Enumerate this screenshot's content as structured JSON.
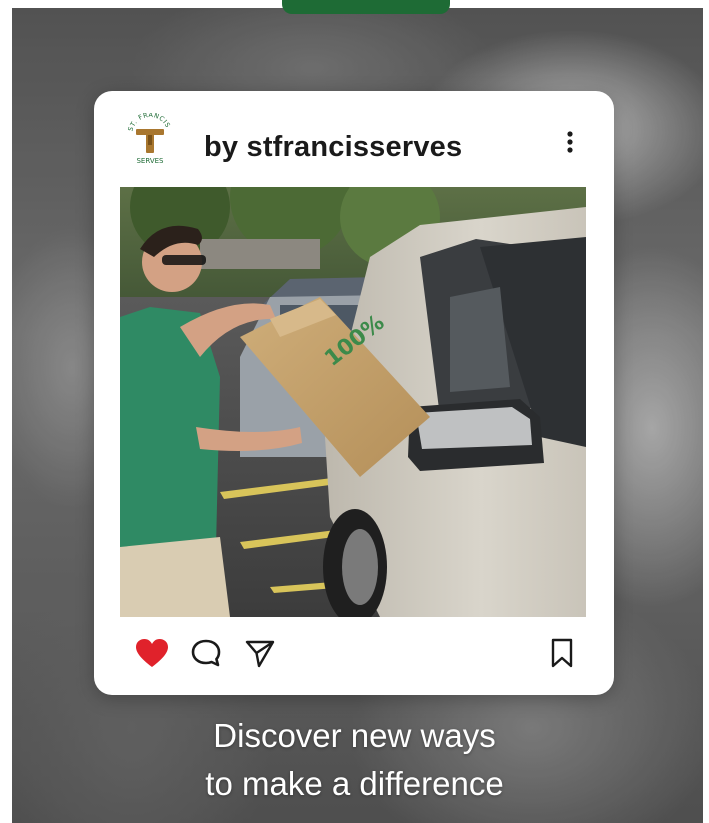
{
  "post": {
    "author_label": "by stfrancisserves",
    "logo_text_top": "ST. FRANCIS",
    "logo_text_bottom": "SERVES",
    "bag_label": "100%"
  },
  "actions": {
    "like_icon": "heart-filled-icon",
    "comment_icon": "comment-bubble-icon",
    "share_icon": "send-paper-plane-icon",
    "save_icon": "bookmark-icon",
    "liked": true
  },
  "tagline": {
    "line1": "Discover new ways",
    "line2": "to make a difference"
  },
  "colors": {
    "brand_green": "#1e6b35",
    "like_red": "#e0222b",
    "card_bg": "#ffffff"
  }
}
